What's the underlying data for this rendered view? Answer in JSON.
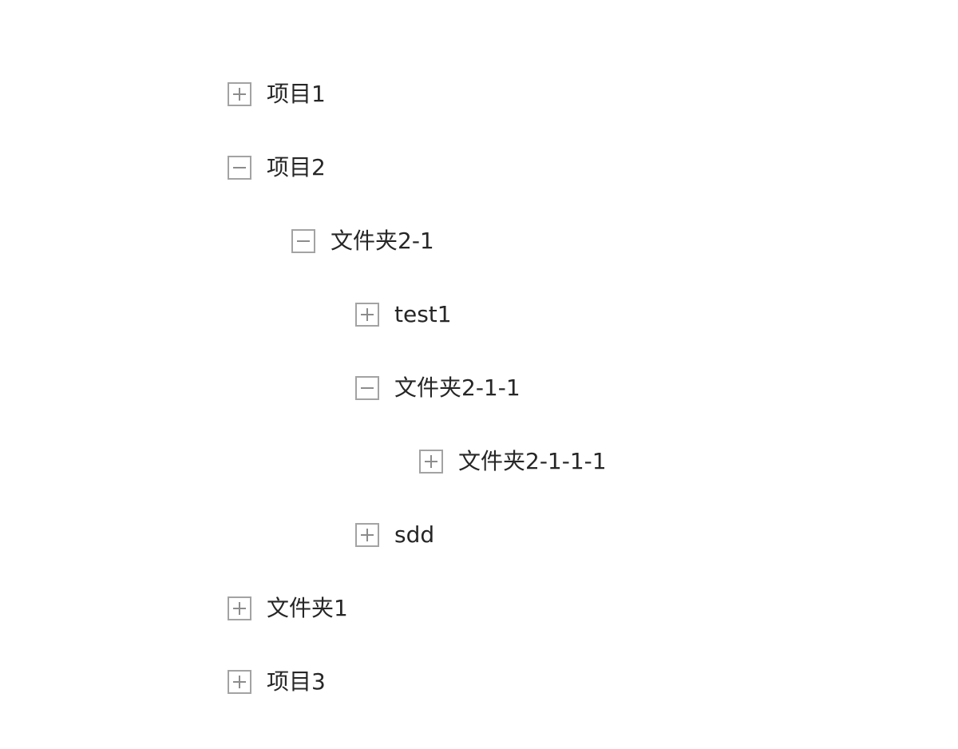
{
  "tree": {
    "nodes": [
      {
        "label": "项目1",
        "expanded": false,
        "icon": "expand-plus-icon"
      },
      {
        "label": "项目2",
        "expanded": true,
        "icon": "collapse-minus-icon"
      },
      {
        "label": "文件夹2-1",
        "expanded": true,
        "icon": "collapse-minus-icon"
      },
      {
        "label": "test1",
        "expanded": false,
        "icon": "expand-plus-icon"
      },
      {
        "label": "文件夹2-1-1",
        "expanded": true,
        "icon": "collapse-minus-icon"
      },
      {
        "label": "文件夹2-1-1-1",
        "expanded": false,
        "icon": "expand-plus-icon"
      },
      {
        "label": "sdd",
        "expanded": false,
        "icon": "expand-plus-icon"
      },
      {
        "label": "文件夹1",
        "expanded": false,
        "icon": "expand-plus-icon"
      },
      {
        "label": "项目3",
        "expanded": false,
        "icon": "expand-plus-icon"
      }
    ]
  },
  "colors": {
    "text": "#262626",
    "toggle_border": "#a3a3a3",
    "toggle_mark": "#8c8c8c",
    "background": "#ffffff"
  }
}
